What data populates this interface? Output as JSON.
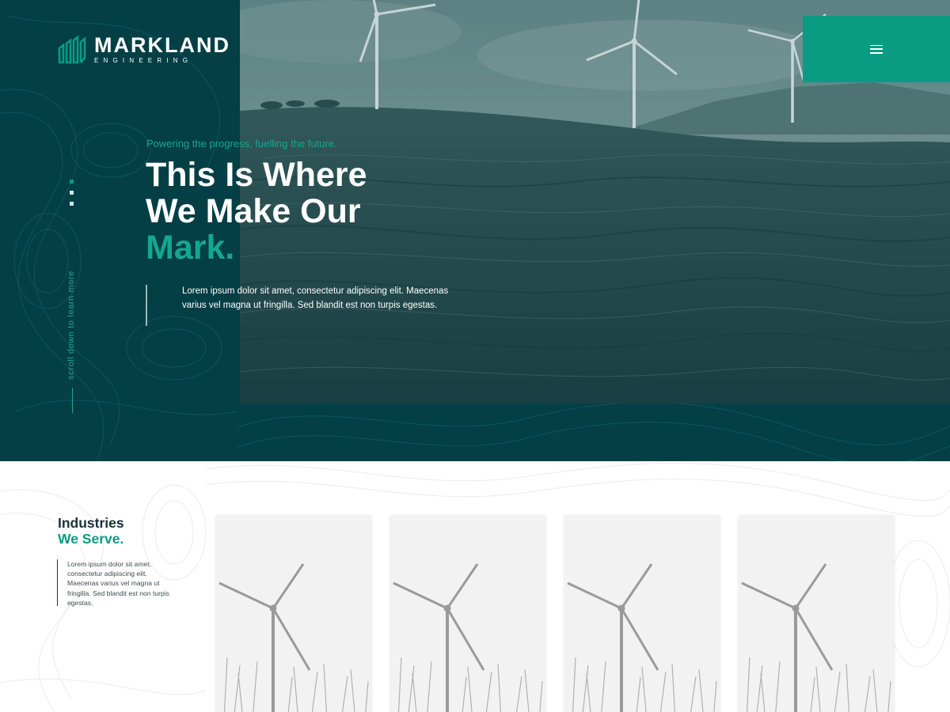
{
  "brand": {
    "name": "MARKLAND",
    "subtitle": "ENGINEERING"
  },
  "header": {
    "menu_icon": "hamburger-icon"
  },
  "hero": {
    "tagline": "Powering the progress, fuelling the future.",
    "headline_line1": "This Is Where",
    "headline_line2": "We Make Our",
    "headline_accent": "Mark.",
    "intro": "Lorem ipsum dolor sit amet, consectetur adipiscing elit. Maecenas varius vel magna ut fringilla. Sed blandit est non turpis egestas.",
    "scroll_hint": "scroll down to learn more",
    "slide_count": 3,
    "active_slide": 1
  },
  "industries": {
    "title_line1": "Industries",
    "title_line2": "We Serve.",
    "text": "Lorem ipsum dolor sit amet, consectetur adipiscing elit. Maecenas varius vel magna ut fringilla. Sed blandit est non turpis egestas.",
    "cards": [
      {
        "image": "wind-turbine-photo"
      },
      {
        "image": "wind-turbine-photo"
      },
      {
        "image": "wind-turbine-photo"
      },
      {
        "image": "wind-turbine-photo"
      }
    ]
  },
  "colors": {
    "hero_bg": "#043f46",
    "accent": "#0a9b83",
    "text_dark": "#16323a"
  }
}
